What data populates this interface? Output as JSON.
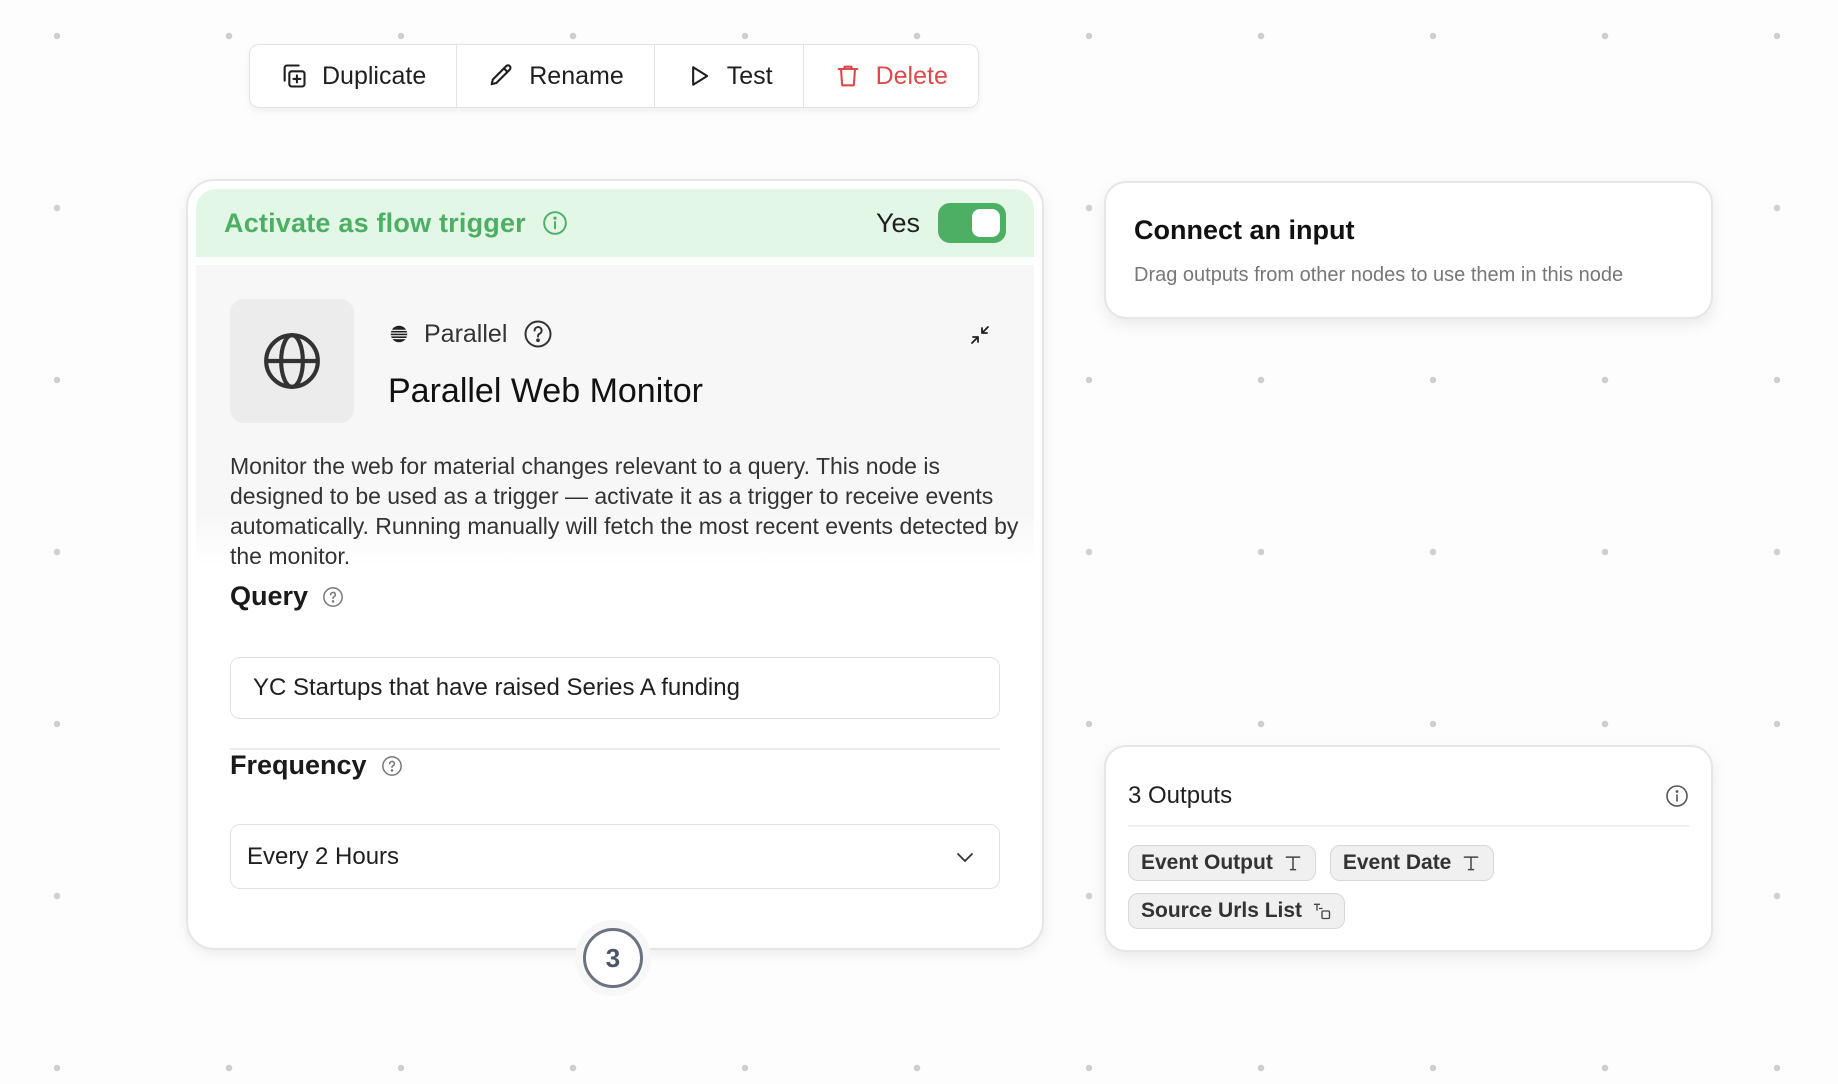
{
  "toolbar": {
    "duplicate_label": "Duplicate",
    "rename_label": "Rename",
    "test_label": "Test",
    "delete_label": "Delete"
  },
  "trigger": {
    "label": "Activate as flow trigger",
    "state_label": "Yes",
    "enabled": true
  },
  "node": {
    "provider": "Parallel",
    "title": "Parallel Web Monitor",
    "description": "Monitor the web for material changes relevant to a query. This node is designed to be used as a trigger — activate it as a trigger to receive events automatically. Running manually will fetch the most recent events detected by the monitor.",
    "query": {
      "label": "Query",
      "value": "YC Startups that have raised Series A funding"
    },
    "frequency": {
      "label": "Frequency",
      "value": "Every 2 Hours"
    },
    "step_number": "3"
  },
  "input_card": {
    "title": "Connect an input",
    "subtitle": "Drag outputs from other nodes to use them in this node"
  },
  "outputs": {
    "title": "3 Outputs",
    "items": [
      {
        "label": "Event Output",
        "type_icon": "text-type-icon"
      },
      {
        "label": "Event Date",
        "type_icon": "text-type-icon"
      },
      {
        "label": "Source Urls List",
        "type_icon": "list-type-icon"
      }
    ]
  },
  "colors": {
    "accent_green": "#4caf63",
    "trigger_bg": "#e3f7e6",
    "danger": "#dc4b4b"
  }
}
